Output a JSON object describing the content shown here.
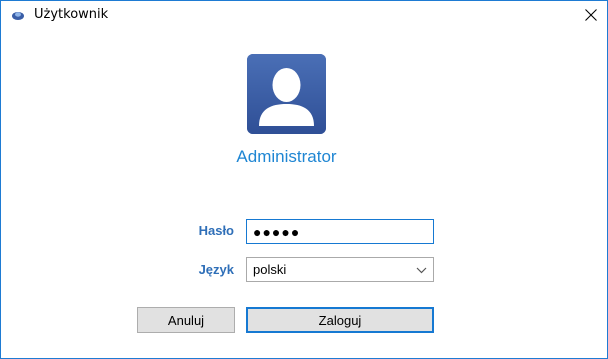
{
  "window": {
    "title": "Użytkownik",
    "icon": "user-app-icon",
    "close_icon": "close-icon"
  },
  "user": {
    "name": "Administrator",
    "avatar_icon": "user-avatar-icon"
  },
  "form": {
    "password_label": "Hasło",
    "password_value": "●●●●●",
    "language_label": "Język",
    "language_value": "polski"
  },
  "buttons": {
    "cancel_label": "Anuluj",
    "login_label": "Zaloguj"
  },
  "colors": {
    "accent": "#1f86d3",
    "avatar_bg": "#3a5ea7",
    "label": "#2f6fb8",
    "focus_border": "#1679d2"
  }
}
